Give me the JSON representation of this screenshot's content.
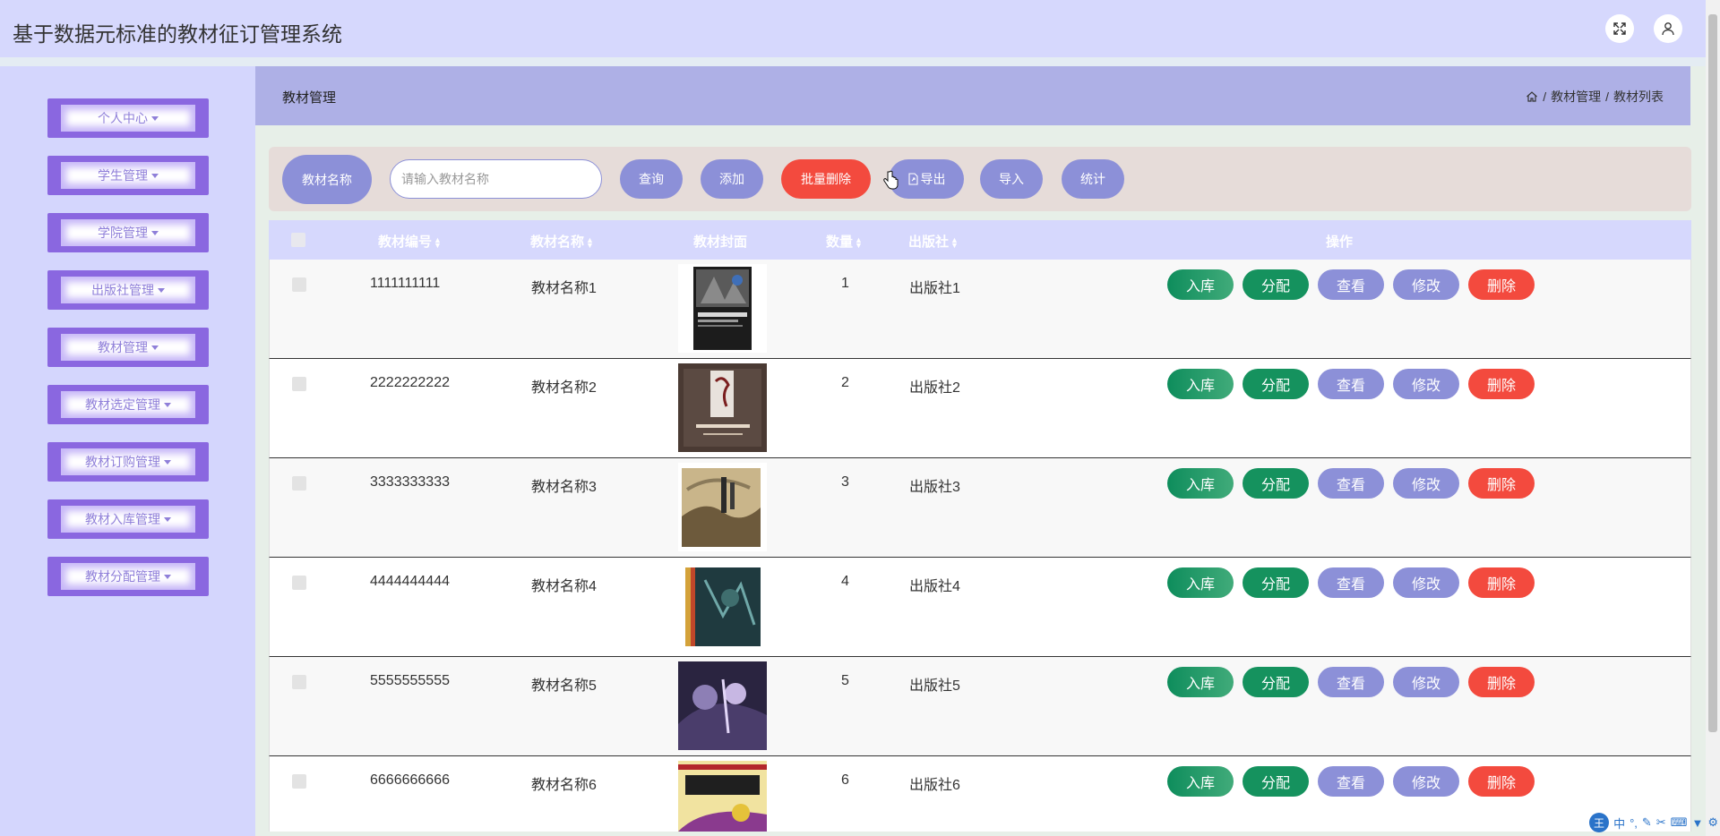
{
  "app_title": "基于数据元标准的教材征订管理系统",
  "topbar_icons": [
    "fullscreen-icon",
    "user-icon"
  ],
  "sidebar": {
    "items": [
      {
        "label": "个人中心"
      },
      {
        "label": "学生管理"
      },
      {
        "label": "学院管理"
      },
      {
        "label": "出版社管理"
      },
      {
        "label": "教材管理"
      },
      {
        "label": "教材选定管理"
      },
      {
        "label": "教材订购管理"
      },
      {
        "label": "教材入库管理"
      },
      {
        "label": "教材分配管理"
      }
    ]
  },
  "header": {
    "title": "教材管理",
    "breadcrumb": [
      "教材管理",
      "教材列表"
    ]
  },
  "search": {
    "label": "教材名称",
    "placeholder": "请输入教材名称",
    "query_label": "查询",
    "add_label": "添加",
    "batch_delete_label": "批量删除",
    "export_label": "导出",
    "import_label": "导入",
    "stats_label": "统计"
  },
  "table": {
    "headers": {
      "id": "教材编号",
      "name": "教材名称",
      "cover": "教材封面",
      "qty": "数量",
      "publisher": "出版社",
      "actions": "操作"
    },
    "action_labels": {
      "stock_in": "入库",
      "assign": "分配",
      "view": "查看",
      "edit": "修改",
      "delete": "删除"
    },
    "rows": [
      {
        "id": "1111111111",
        "name": "教材名称1",
        "qty": "1",
        "publisher": "出版社1"
      },
      {
        "id": "2222222222",
        "name": "教材名称2",
        "qty": "2",
        "publisher": "出版社2"
      },
      {
        "id": "3333333333",
        "name": "教材名称3",
        "qty": "3",
        "publisher": "出版社3"
      },
      {
        "id": "4444444444",
        "name": "教材名称4",
        "qty": "4",
        "publisher": "出版社4"
      },
      {
        "id": "5555555555",
        "name": "教材名称5",
        "qty": "5",
        "publisher": "出版社5"
      },
      {
        "id": "6666666666",
        "name": "教材名称6",
        "qty": "6",
        "publisher": "出版社6"
      }
    ]
  },
  "ime": {
    "badge": "王",
    "mode": "中"
  },
  "colors": {
    "accent": "#8c90d8",
    "danger": "#f34a3e",
    "success": "#15925e",
    "sidebar": "#d4d6fd"
  }
}
